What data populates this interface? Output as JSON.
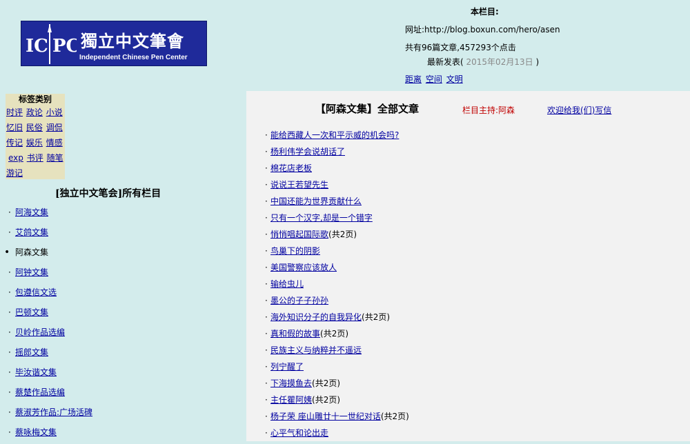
{
  "logo": {
    "mark_left": "IC",
    "mark_right": "PC",
    "name_cn": "獨立中文筆會",
    "name_en": "Independent Chinese Pen Center"
  },
  "header": {
    "section_label": "本栏目:",
    "url_text": "网址:http://blog.boxun.com/hero/asen",
    "stats_text": "共有96篇文章,457293个点击",
    "latest_label": "最新发表(",
    "latest_date": "2015年02月13日",
    "latest_close": ")",
    "links": [
      "距离",
      "空间",
      "文明"
    ]
  },
  "tags": {
    "heading": "标签类别",
    "rows": [
      [
        "时评",
        "政论",
        "小说"
      ],
      [
        "忆旧",
        "民俗",
        "调侃"
      ],
      [
        "传记",
        "娱乐",
        "情感"
      ],
      [
        "exp",
        "书评",
        "随笔"
      ],
      [
        "游记"
      ]
    ]
  },
  "columns": {
    "title": "[独立中文笔会]所有栏目",
    "items": [
      {
        "label": "阿海文集",
        "current": false
      },
      {
        "label": "艾鸽文集",
        "current": false
      },
      {
        "label": "阿森文集",
        "current": true
      },
      {
        "label": "阿钟文集",
        "current": false
      },
      {
        "label": "包遵信文选",
        "current": false
      },
      {
        "label": "巴顿文集",
        "current": false
      },
      {
        "label": "贝岭作品选编",
        "current": false
      },
      {
        "label": "摇郎文集",
        "current": false
      },
      {
        "label": "毕汝谐文集",
        "current": false
      },
      {
        "label": "蔡楚作品选编",
        "current": false
      },
      {
        "label": "蔡淑芳作品:广场活碑",
        "current": false
      },
      {
        "label": "蔡咏梅文集",
        "current": false
      }
    ]
  },
  "main": {
    "title": "【阿森文集】全部文章",
    "host": "栏目主持:阿森",
    "contact": "欢迎给我(们)写信",
    "articles": [
      {
        "title": "能给西藏人一次和平示威的机会吗?",
        "pages": ""
      },
      {
        "title": "杨利伟学会说胡话了",
        "pages": ""
      },
      {
        "title": "棉花店老板",
        "pages": ""
      },
      {
        "title": "说说王若望先生",
        "pages": ""
      },
      {
        "title": "中国还能为世界贡献什么",
        "pages": ""
      },
      {
        "title": "只有一个汉字,却是一个错字",
        "pages": ""
      },
      {
        "title": "悄悄唱起国际歌",
        "pages": "(共2页)"
      },
      {
        "title": "鸟巢下的阴影",
        "pages": ""
      },
      {
        "title": "美国警察应该放人",
        "pages": ""
      },
      {
        "title": "输给虫儿",
        "pages": ""
      },
      {
        "title": "墨公的子子孙孙",
        "pages": ""
      },
      {
        "title": "海外知识分子的自我异化",
        "pages": "(共2页)"
      },
      {
        "title": "真和假的故事",
        "pages": "(共2页)"
      },
      {
        "title": "民族主义与纳粹并不遥远",
        "pages": ""
      },
      {
        "title": "列宁醒了",
        "pages": ""
      },
      {
        "title": "下海摸鱼去",
        "pages": "(共2页)"
      },
      {
        "title": "主任瞿阿姨",
        "pages": "(共2页)"
      },
      {
        "title": "杨子荣 座山雕廿十一世纪对话",
        "pages": "(共2页)"
      },
      {
        "title": "心平气和论出走",
        "pages": ""
      }
    ]
  }
}
